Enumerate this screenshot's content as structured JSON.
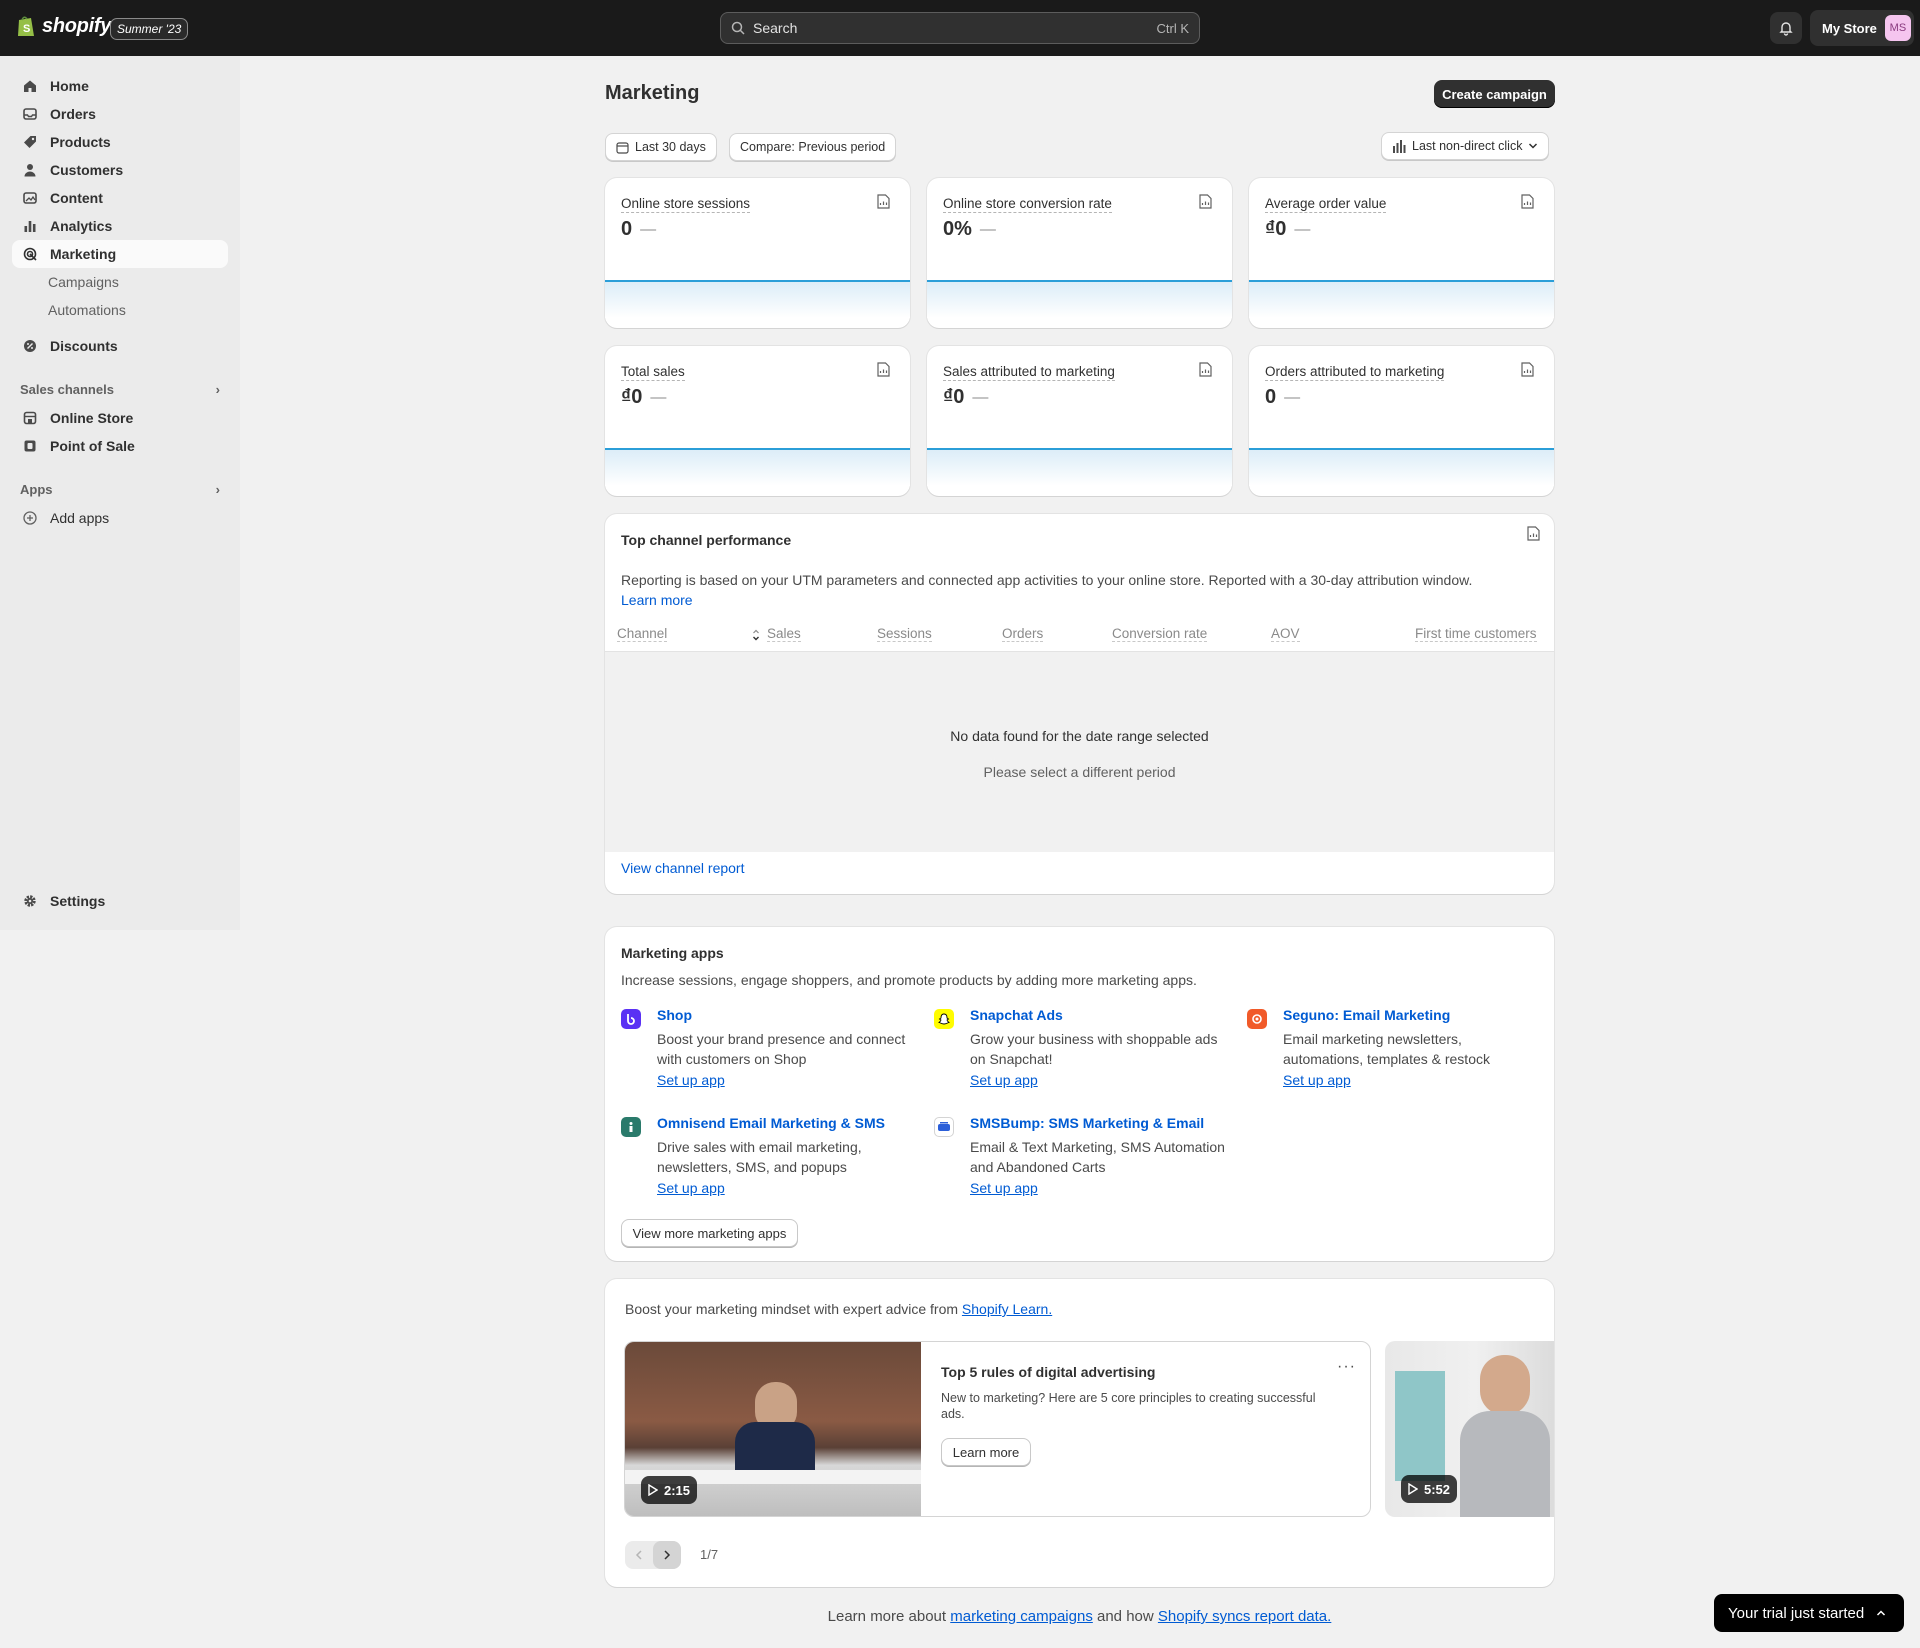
{
  "topbar": {
    "brand": "shopify",
    "edition": "Summer '23",
    "search_placeholder": "Search",
    "search_shortcut": "Ctrl K",
    "store_name": "My Store",
    "avatar_initials": "MS"
  },
  "sidebar": {
    "items": [
      {
        "label": "Home",
        "icon": "home-icon"
      },
      {
        "label": "Orders",
        "icon": "inbox-icon"
      },
      {
        "label": "Products",
        "icon": "tag-icon"
      },
      {
        "label": "Customers",
        "icon": "person-icon"
      },
      {
        "label": "Content",
        "icon": "image-icon"
      },
      {
        "label": "Analytics",
        "icon": "bar-chart-icon"
      },
      {
        "label": "Marketing",
        "icon": "target-icon"
      },
      {
        "label": "Campaigns"
      },
      {
        "label": "Automations"
      },
      {
        "label": "Discounts",
        "icon": "discount-icon"
      }
    ],
    "sales_channels_label": "Sales channels",
    "channels": [
      {
        "label": "Online Store",
        "icon": "storefront-icon"
      },
      {
        "label": "Point of Sale",
        "icon": "pos-icon"
      }
    ],
    "apps_label": "Apps",
    "add_apps": "Add apps",
    "settings": "Settings"
  },
  "page": {
    "title": "Marketing",
    "create_campaign": "Create campaign",
    "date_range": "Last 30 days",
    "compare": "Compare: Previous period",
    "attribution": "Last non-direct click"
  },
  "metrics": [
    {
      "title": "Online store sessions",
      "value": "0",
      "change": "—"
    },
    {
      "title": "Online store conversion rate",
      "value": "0%",
      "change": "—"
    },
    {
      "title": "Average order value",
      "value": "₫0",
      "change": "—"
    },
    {
      "title": "Total sales",
      "value": "₫0",
      "change": "—"
    },
    {
      "title": "Sales attributed to marketing",
      "value": "₫0",
      "change": "—"
    },
    {
      "title": "Orders attributed to marketing",
      "value": "0",
      "change": "—"
    }
  ],
  "channels": {
    "title": "Top channel performance",
    "description": "Reporting is based on your UTM parameters and connected app activities to your online store. Reported with a 30-day attribution window.",
    "learn_more": "Learn more",
    "columns": [
      "Channel",
      "Sales",
      "Sessions",
      "Orders",
      "Conversion rate",
      "AOV",
      "First time customers"
    ],
    "empty_title": "No data found for the date range selected",
    "empty_sub": "Please select a different period",
    "view_report": "View channel report"
  },
  "marketing_apps": {
    "title": "Marketing apps",
    "description": "Increase sessions, engage shoppers, and promote products by adding more marketing apps.",
    "apps": [
      {
        "name": "Shop",
        "desc": "Boost your brand presence and connect with customers on Shop",
        "setup": "Set up app",
        "color": "#5a31f4"
      },
      {
        "name": "Snapchat Ads",
        "desc": "Grow your business with shoppable ads on Snapchat!",
        "setup": "Set up app",
        "color": "#fffc00"
      },
      {
        "name": "Seguno: Email Marketing",
        "desc": "Email marketing newsletters, automations, templates & restock",
        "setup": "Set up app",
        "color": "#f15a29"
      },
      {
        "name": "Omnisend Email Marketing & SMS",
        "desc": "Drive sales with email marketing, newsletters, SMS, and popups",
        "setup": "Set up app",
        "color": "#2a7a6b"
      },
      {
        "name": "SMSBump: SMS Marketing & Email",
        "desc": "Email & Text Marketing, SMS Automation and Abandoned Carts",
        "setup": "Set up app",
        "color": "#2b5fd9"
      }
    ],
    "view_more": "View more marketing apps"
  },
  "learn": {
    "intro": "Boost your marketing mindset with expert advice from",
    "intro_link": "Shopify Learn.",
    "video1_duration": "2:15",
    "video1_title": "Top 5 rules of digital advertising",
    "video1_desc": "New to marketing? Here are 5 core principles to creating successful ads.",
    "video1_button": "Learn more",
    "video2_duration": "5:52",
    "pager": "1/7"
  },
  "footer": {
    "prefix": "Learn more about",
    "link1": "marketing campaigns",
    "middle": "and how",
    "link2": "Shopify syncs report data."
  },
  "trial": "Your trial just started"
}
